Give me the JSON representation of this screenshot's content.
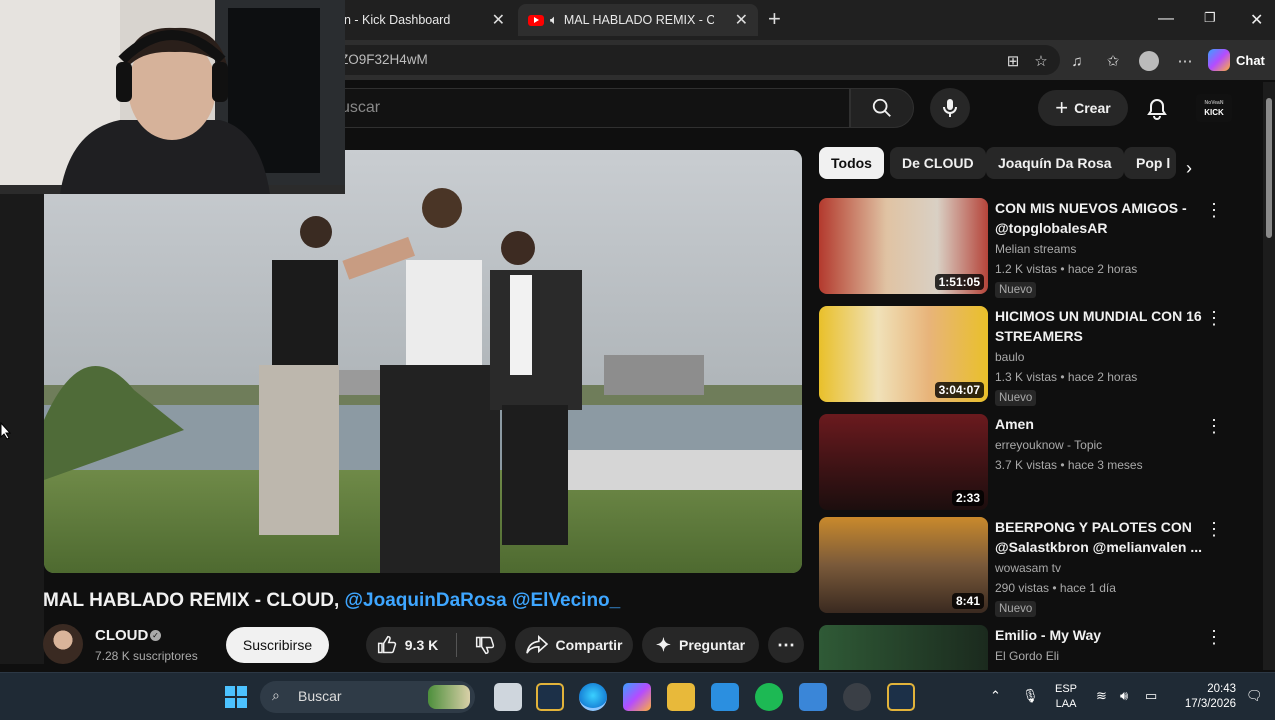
{
  "browser": {
    "tabs": [
      {
        "title": "n - Kick Dashboard"
      },
      {
        "title": "MAL HABLADO REMIX - CLOUD"
      }
    ],
    "url": "ZO9F32H4wM",
    "chat_label": "Chat"
  },
  "youtube": {
    "search_placeholder": "uscar",
    "create_label": "Crear",
    "channel_badge_line1": "NoVeaN",
    "channel_badge_line2": "KICK"
  },
  "video": {
    "title_main": "MAL HABLADO REMIX - CLOUD, ",
    "title_mentions": "@JoaquinDaRosa @ElVecino_",
    "channel_name": "CLOUD",
    "subscribers": "7.28 K suscriptores",
    "subscribe_label": "Suscribirse",
    "likes": "9.3 K",
    "share_label": "Compartir",
    "ask_label": "Preguntar"
  },
  "chips": [
    "Todos",
    "De CLOUD",
    "Joaquín Da Rosa",
    "Pop l"
  ],
  "recommendations": [
    {
      "title": "CON MIS NUEVOS AMIGOS  - @topglobalesAR",
      "channel": "Melian streams",
      "meta": "1.2 K vistas • hace 2 horas",
      "duration": "1:51:05",
      "badge": "Nuevo",
      "thumb_color": "#b33a2e"
    },
    {
      "title": "HICIMOS UN MUNDIAL CON 16 STREAMERS",
      "channel": "baulo",
      "meta": "1.3 K vistas • hace 2 horas",
      "duration": "3:04:07",
      "badge": "Nuevo",
      "thumb_color": "#e9c02a"
    },
    {
      "title": "Amen",
      "channel": "erreyouknow - Topic",
      "meta": "3.7 K vistas • hace 3 meses",
      "duration": "2:33",
      "badge": "",
      "thumb_color": "#6b1a1e"
    },
    {
      "title": "BEERPONG Y PALOTES CON @Salastkbron @melianvalen ...",
      "channel": "wowasam tv",
      "meta": "290 vistas • hace 1 día",
      "duration": "8:41",
      "badge": "Nuevo",
      "thumb_color": "#c98a2c"
    },
    {
      "title": "Emilio - My Way",
      "channel": "El Gordo Eli",
      "meta": "",
      "duration": "",
      "badge": "",
      "thumb_color": "#2f5a36"
    }
  ],
  "taskbar": {
    "search_label": "Buscar",
    "lang_line1": "ESP",
    "lang_line2": "LAA",
    "time": "20:43",
    "date": "17/3/2026"
  },
  "colors": {
    "accent_link": "#3ea6ff",
    "background": "#0f0f0f"
  }
}
